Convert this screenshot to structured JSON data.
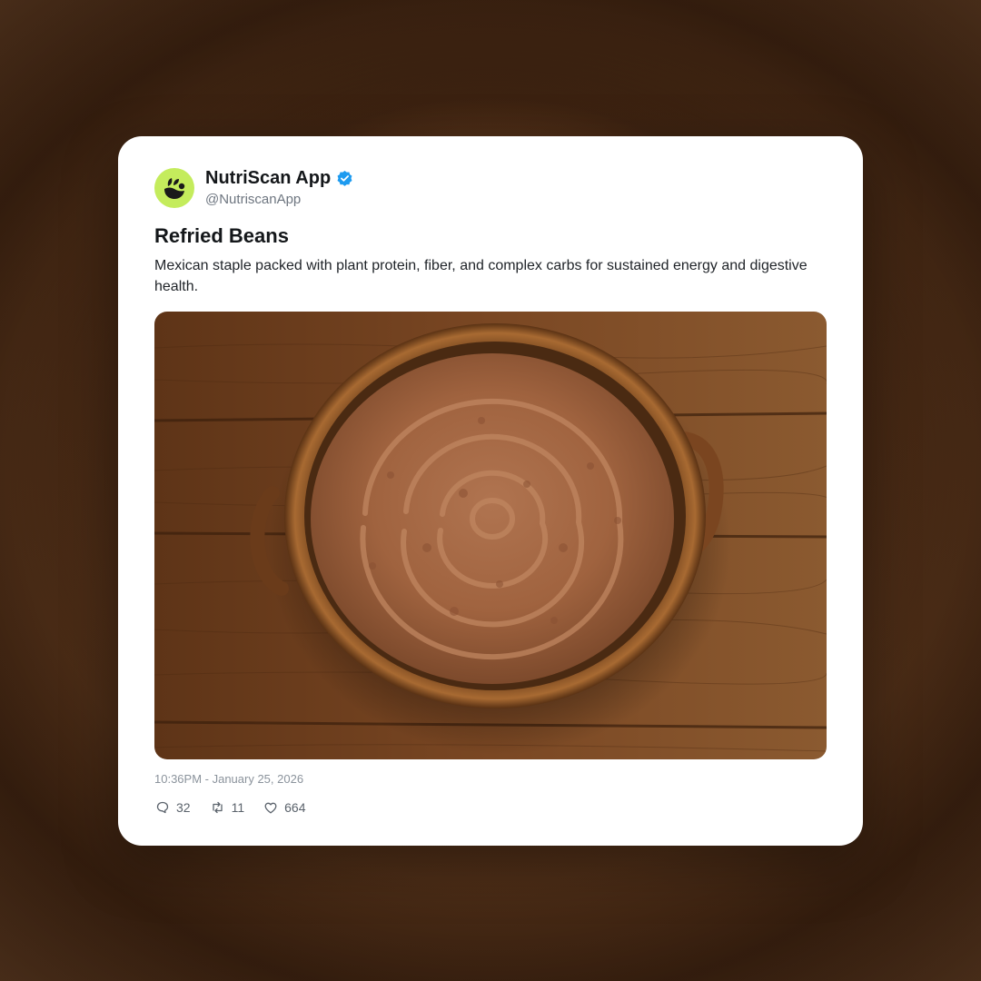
{
  "post": {
    "author_name": "NutriScan App",
    "handle": "@NutriscanApp",
    "verified": true,
    "title": "Refried Beans",
    "description": "Mexican staple packed with plant protein, fiber, and complex carbs for sustained energy and digestive health.",
    "timestamp": "10:36PM - January 25, 2026",
    "image_subject": "bowl of refried beans on wooden table",
    "stats": {
      "replies": "32",
      "retweets": "11",
      "likes": "664"
    }
  },
  "icons": {
    "avatar": "leaf-logo-icon",
    "verified": "verified-badge-icon",
    "replies": "speech-bubble-icon",
    "retweets": "retweet-icon",
    "likes": "heart-icon"
  },
  "colors": {
    "avatar_bg": "#c4ec5c",
    "verified_blue": "#1d9bf0",
    "text_primary": "#14171a",
    "text_muted": "#6e7680"
  }
}
